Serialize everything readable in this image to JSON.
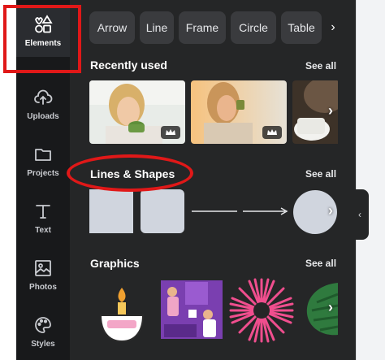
{
  "sidebar": {
    "items": [
      {
        "label": "Elements",
        "icon": "elements-icon",
        "active": true
      },
      {
        "label": "Uploads",
        "icon": "upload-cloud-icon"
      },
      {
        "label": "Projects",
        "icon": "folder-icon"
      },
      {
        "label": "Text",
        "icon": "text-icon"
      },
      {
        "label": "Photos",
        "icon": "photo-icon"
      },
      {
        "label": "Styles",
        "icon": "palette-icon"
      }
    ]
  },
  "chips": [
    "Arrow",
    "Line",
    "Frame",
    "Circle",
    "Table"
  ],
  "sections": {
    "recent": {
      "title": "Recently used",
      "see_all": "See all"
    },
    "lines_shapes": {
      "title": "Lines & Shapes",
      "see_all": "See all"
    },
    "graphics": {
      "title": "Graphics",
      "see_all": "See all"
    }
  },
  "colors": {
    "rail_bg": "#18191b",
    "panel_bg": "#252627",
    "chip_bg": "#3a3b3e",
    "shape_fill": "#d0d5de",
    "annotation_red": "#e01818"
  }
}
